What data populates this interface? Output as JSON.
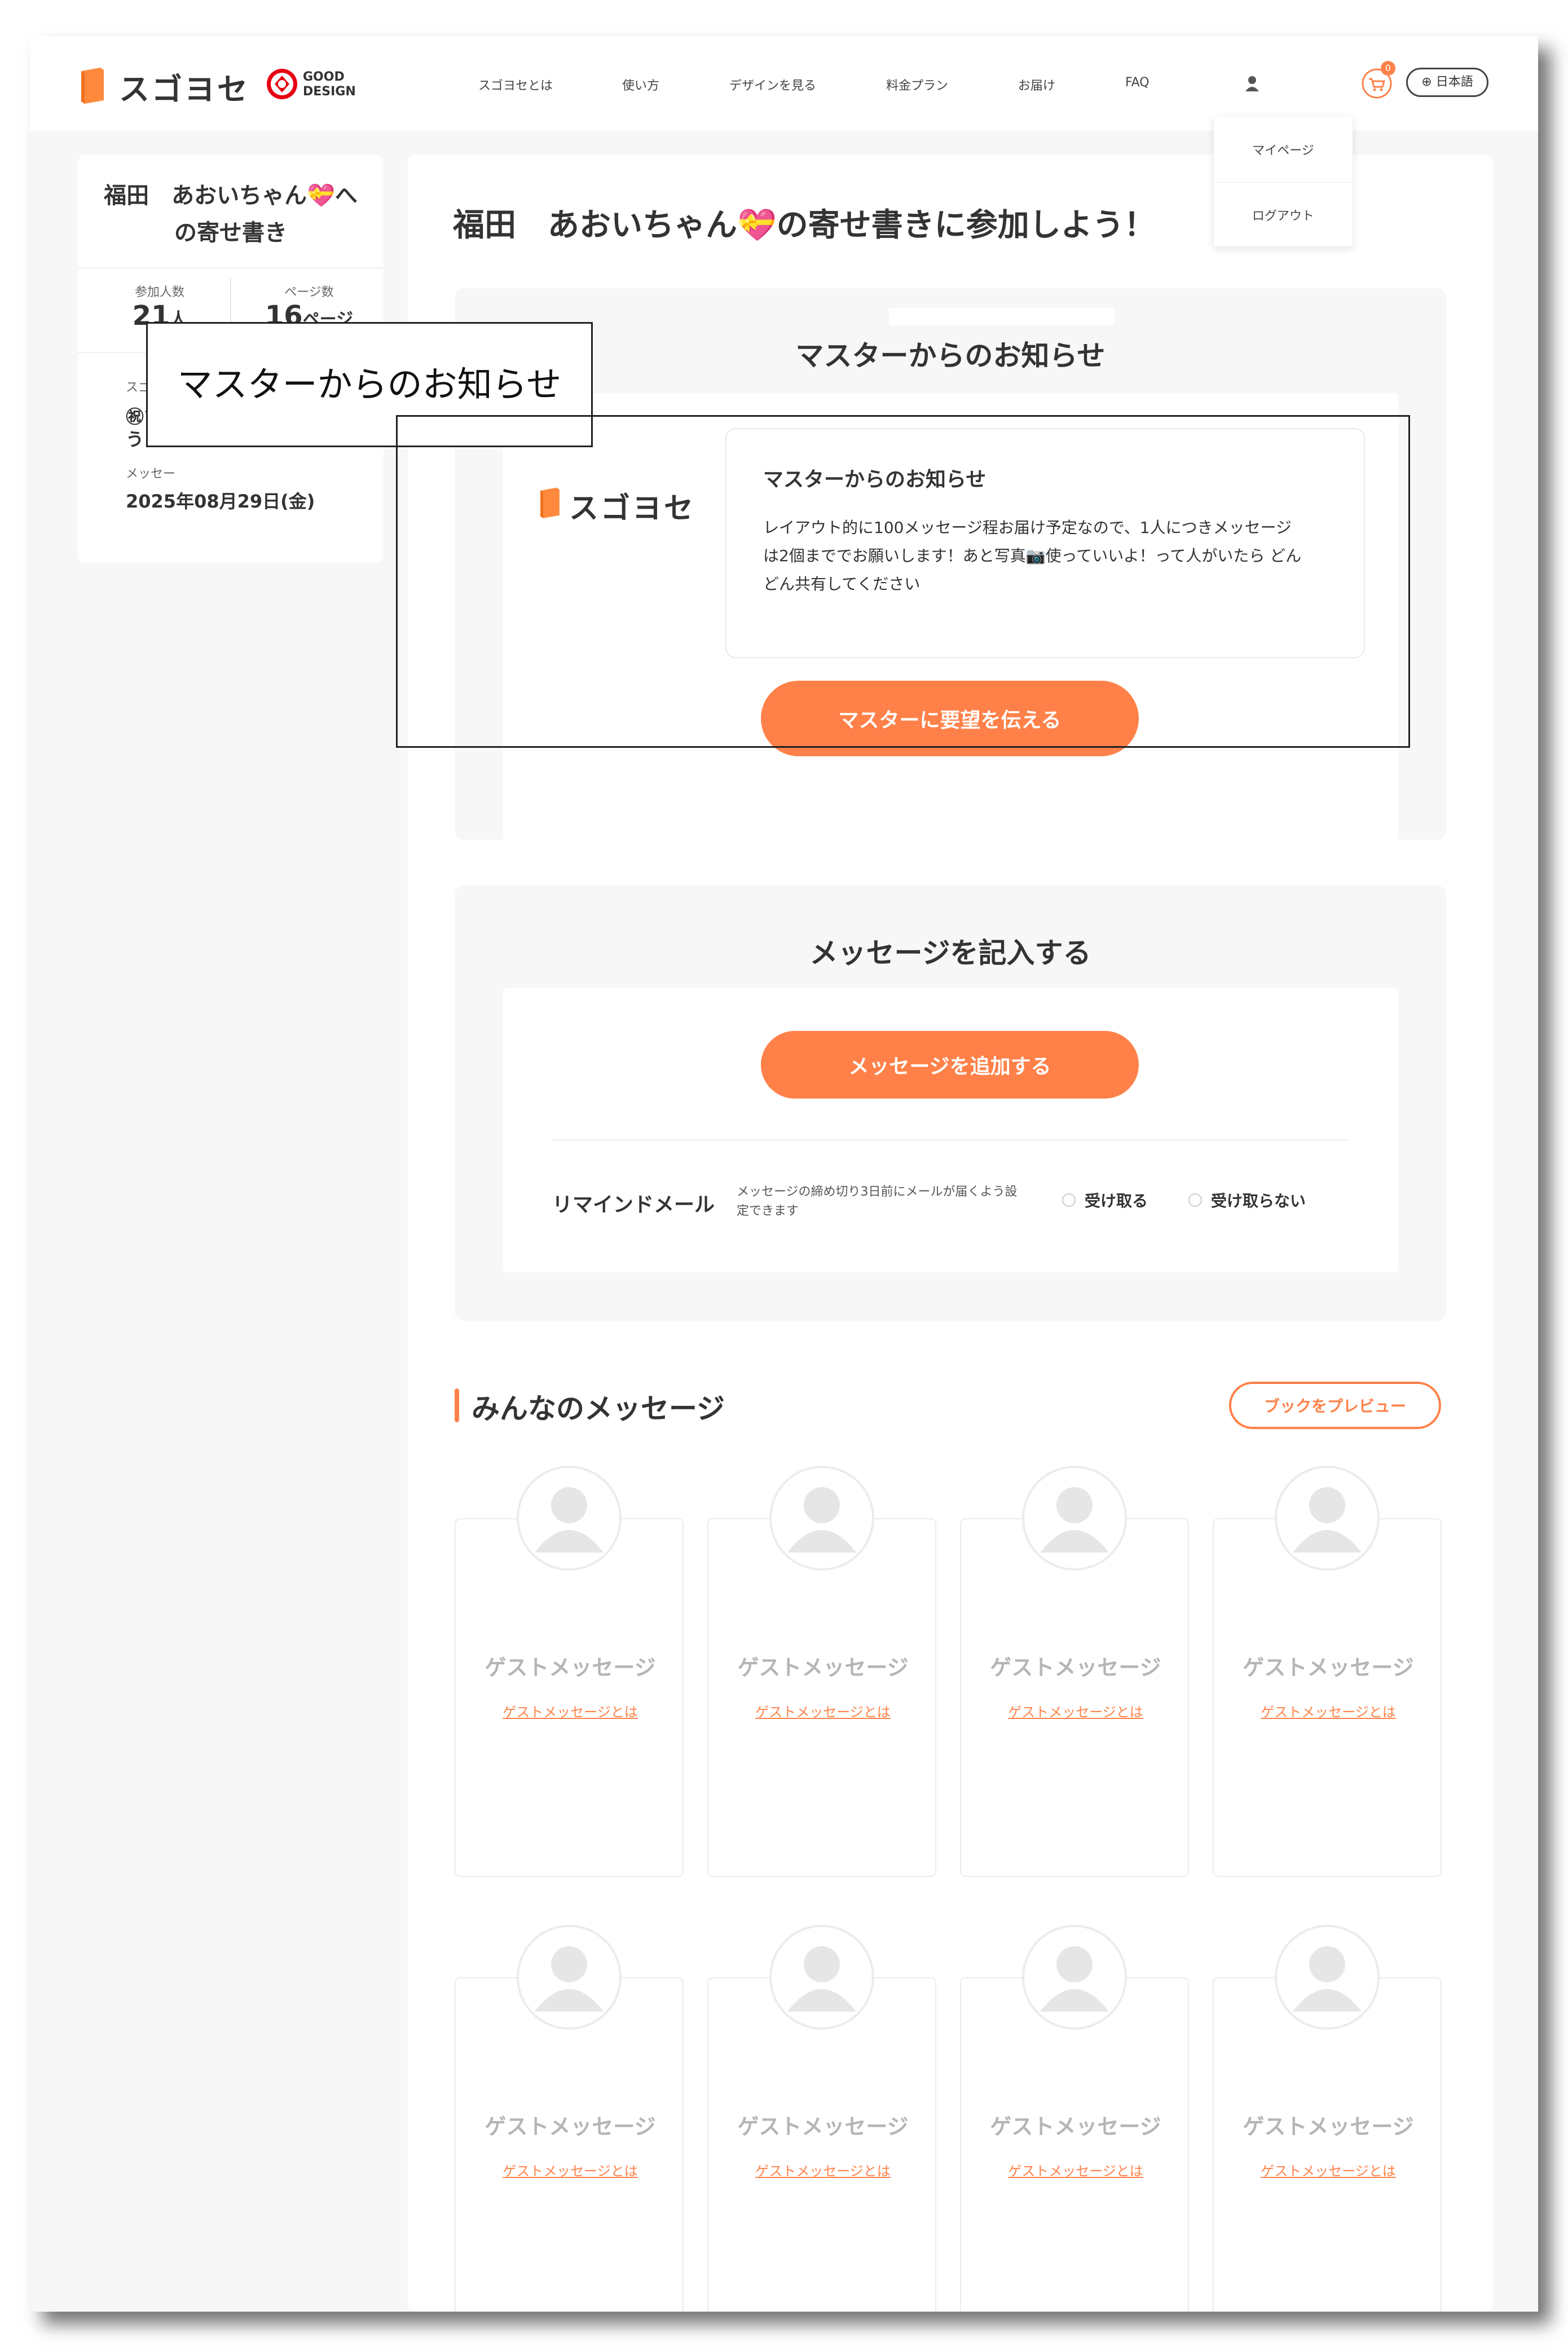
{
  "header": {
    "logo_text": "スゴヨセ",
    "gooddesign_line1": "GOOD",
    "gooddesign_line2": "DESIGN",
    "nav": [
      "スゴヨセとは",
      "使い方",
      "デザインを見る",
      "料金プラン",
      "お届け",
      "FAQ"
    ],
    "cart_count": "0",
    "language": "日本語"
  },
  "user_menu": {
    "items": [
      "マイページ",
      "ログアウト"
    ]
  },
  "sidebar": {
    "title": "福田　あおいちゃん💝への寄せ書き",
    "participants_label": "参加人数",
    "participants_value": "21",
    "participants_unit": "人",
    "pages_label": "ページ数",
    "pages_value": "16",
    "pages_unit": "ページ",
    "master_label": "スゴヨセ",
    "master_text_1": "㊗ツア",
    "master_text_2": "う！",
    "deadline_label": "メッセー",
    "deadline_value": "2025年08月29日(金)"
  },
  "main": {
    "title": "福田　あおいちゃん💝の寄せ書きに参加しよう！",
    "notice": {
      "panel_title": "マスターからのお知らせ",
      "brand": "スゴヨセ",
      "box_title": "マスターからのお知らせ",
      "body_line1": "レイアウト的に100メッセージ程お届け予定なので、1人につきメッセージ",
      "body_line2": "は2個まででお願いします！あと写真📷使っていいよ！って人がいたら どん",
      "body_line3": "どん共有してください",
      "button": "マスターに要望を伝える"
    },
    "compose": {
      "panel_title": "メッセージを記入する",
      "add_button": "メッセージを追加する",
      "remind_label": "リマインドメール",
      "remind_desc_1": "メッセージの締め切り3日前にメールが届くよう設",
      "remind_desc_2": "定できます",
      "option_receive": "受け取る",
      "option_not_receive": "受け取らない"
    },
    "messages": {
      "section_title": "みんなのメッセージ",
      "preview_button": "ブックをプレビュー",
      "cards": [
        {
          "title": "ゲストメッセージ",
          "link": "ゲストメッセージとは"
        },
        {
          "title": "ゲストメッセージ",
          "link": "ゲストメッセージとは"
        },
        {
          "title": "ゲストメッセージ",
          "link": "ゲストメッセージとは"
        },
        {
          "title": "ゲストメッセージ",
          "link": "ゲストメッセージとは"
        },
        {
          "title": "ゲストメッセージ",
          "link": "ゲストメッセージとは"
        },
        {
          "title": "ゲストメッセージ",
          "link": "ゲストメッセージとは"
        },
        {
          "title": "ゲストメッセージ",
          "link": "ゲストメッセージとは"
        },
        {
          "title": "ゲストメッセージ",
          "link": "ゲストメッセージとは"
        }
      ]
    }
  },
  "annotation": {
    "label": "マスターからのお知らせ"
  },
  "colors": {
    "accent": "#ff8149",
    "page_bg": "#f7f7f7",
    "card_title": "#b5b5b5"
  }
}
